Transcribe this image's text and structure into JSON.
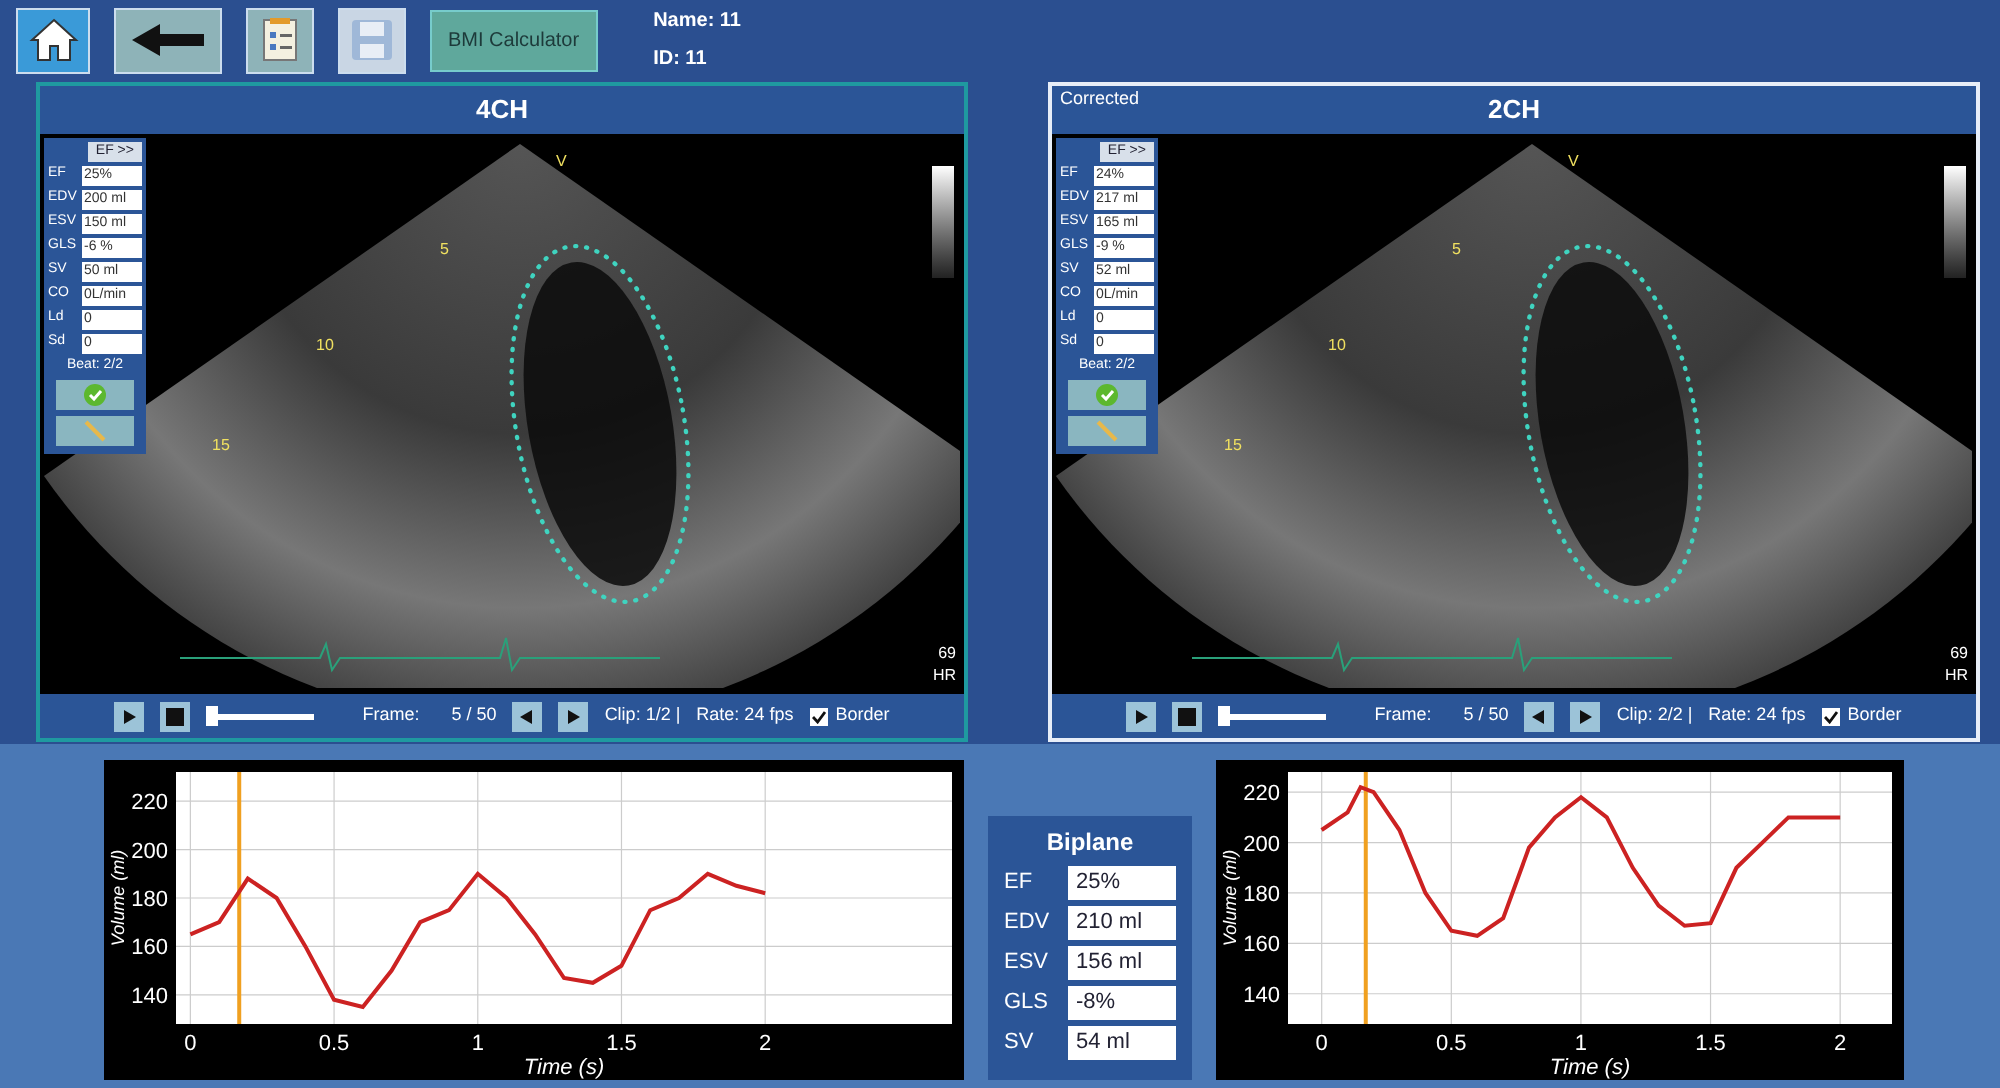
{
  "toolbar": {
    "buttons": [
      {
        "kind": "home"
      },
      {
        "kind": "back"
      },
      {
        "kind": "report"
      },
      {
        "kind": "save",
        "disabled": true
      },
      {
        "kind": "text",
        "label": "BMI Calculator"
      }
    ],
    "patient": {
      "name": "Name: 11",
      "id": "ID: 11"
    }
  },
  "views": [
    {
      "title": "4CH",
      "selected": false,
      "ef_button": "EF >>",
      "measurements": [
        {
          "label": "EF",
          "value": "25%"
        },
        {
          "label": "EDV",
          "value": "200 ml"
        },
        {
          "label": "ESV",
          "value": "150 ml"
        },
        {
          "label": "GLS",
          "value": "-6 %"
        },
        {
          "label": "SV",
          "value": "50 ml"
        },
        {
          "label": "CO",
          "value": "0L/min"
        },
        {
          "label": "Ld",
          "value": "0"
        },
        {
          "label": "Sd",
          "value": "0"
        }
      ],
      "beat": "Beat: 2/2",
      "depth_marks": [
        "V",
        "5",
        "10",
        "15"
      ],
      "hr_value": "69",
      "hr_label": "HR",
      "controls": {
        "slider": {
          "level": 0.05
        },
        "frame_label": "Frame:",
        "frame": "5 / 50",
        "clip": "Clip: 1/2 |",
        "rate": "Rate: 24 fps",
        "border": {
          "label": "Border",
          "checked": true
        }
      }
    },
    {
      "title": "2CH",
      "selected": true,
      "note": "Corrected",
      "ef_button": "EF >>",
      "measurements": [
        {
          "label": "EF",
          "value": "24%"
        },
        {
          "label": "EDV",
          "value": "217 ml"
        },
        {
          "label": "ESV",
          "value": "165 ml"
        },
        {
          "label": "GLS",
          "value": "-9 %"
        },
        {
          "label": "SV",
          "value": "52 ml"
        },
        {
          "label": "CO",
          "value": "0L/min"
        },
        {
          "label": "Ld",
          "value": "0"
        },
        {
          "label": "Sd",
          "value": "0"
        }
      ],
      "beat": "Beat: 2/2",
      "depth_marks": [
        "V",
        "5",
        "10",
        "15"
      ],
      "hr_value": "69",
      "hr_label": "HR",
      "controls": {
        "slider": {
          "level": 0.05
        },
        "frame_label": "Frame:",
        "frame": "5 / 50",
        "clip": "Clip: 2/2 |",
        "rate": "Rate: 24 fps",
        "border": {
          "label": "Border",
          "checked": true
        }
      }
    }
  ],
  "charts": [
    {
      "chart_data": {
        "type": "line",
        "xlabel": "Time (s)",
        "ylabel": "Volume (ml)",
        "xlim": [
          -0.05,
          2.65
        ],
        "ylim": [
          128,
          232
        ],
        "xticks": [
          0,
          0.5,
          1,
          1.5,
          2
        ],
        "yticks": [
          140,
          160,
          180,
          200,
          220
        ],
        "x": [
          0,
          0.1,
          0.2,
          0.3,
          0.4,
          0.5,
          0.6,
          0.7,
          0.8,
          0.9,
          1.0,
          1.1,
          1.2,
          1.3,
          1.4,
          1.5,
          1.6,
          1.7,
          1.8,
          1.9,
          2.0
        ],
        "grid": true,
        "ref_lines": [
          {
            "axis": "x",
            "value": 0.17,
            "color": "#f0a020"
          }
        ],
        "series": [
          {
            "color": "#cc2222",
            "values": [
              165,
              170,
              188,
              180,
              160,
              138,
              135,
              150,
              170,
              175,
              190,
              180,
              165,
              147,
              145,
              152,
              175,
              180,
              190,
              185,
              182
            ]
          }
        ]
      }
    },
    {
      "chart_data": {
        "type": "line",
        "xlabel": "Time (s)",
        "ylabel": "Volume (ml)",
        "xlim": [
          -0.13,
          2.2
        ],
        "ylim": [
          128,
          228
        ],
        "xticks": [
          0,
          0.5,
          1,
          1.5,
          2
        ],
        "yticks": [
          140,
          160,
          180,
          200,
          220
        ],
        "x": [
          0,
          0.1,
          0.15,
          0.2,
          0.3,
          0.4,
          0.5,
          0.6,
          0.7,
          0.8,
          0.9,
          1.0,
          1.1,
          1.2,
          1.3,
          1.4,
          1.5,
          1.6,
          1.7,
          1.8,
          1.9,
          2.0
        ],
        "grid": true,
        "ref_lines": [
          {
            "axis": "x",
            "value": 0.17,
            "color": "#f0a020"
          }
        ],
        "series": [
          {
            "color": "#cc2222",
            "values": [
              205,
              212,
              222,
              220,
              205,
              180,
              165,
              163,
              170,
              198,
              210,
              218,
              210,
              190,
              175,
              167,
              168,
              190,
              200,
              210,
              210,
              210
            ]
          }
        ]
      }
    }
  ],
  "biplane": {
    "title": "Biplane",
    "rows": [
      {
        "label": "EF",
        "value": "25%"
      },
      {
        "label": "EDV",
        "value": "210 ml"
      },
      {
        "label": "ESV",
        "value": "156 ml"
      },
      {
        "label": "GLS",
        "value": "-8%"
      },
      {
        "label": "SV",
        "value": "54 ml"
      }
    ]
  }
}
